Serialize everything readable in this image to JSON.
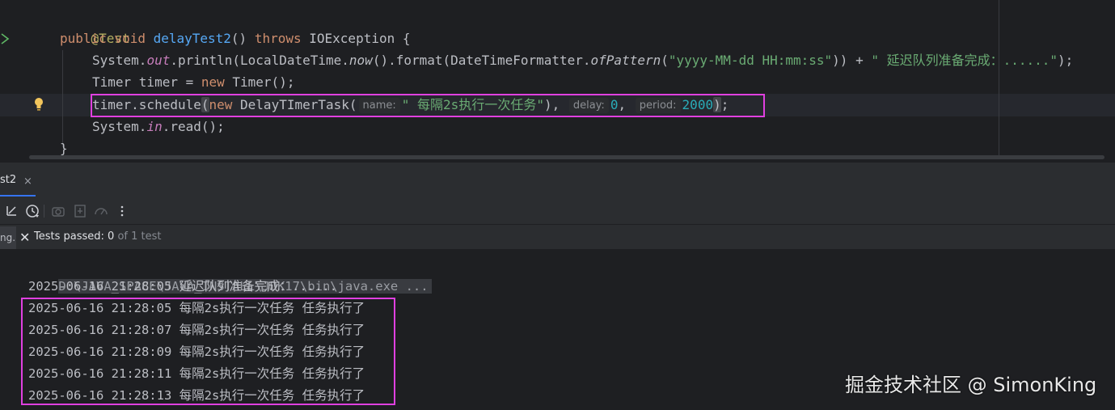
{
  "editor": {
    "lines": {
      "l1": "@Test",
      "l2_kw1": "public void ",
      "l2_fn": "delayTest2",
      "l2_rest": "() ",
      "l2_kw2": "throws ",
      "l2_exc": "IOException {",
      "l3_a": "System.",
      "l3_out": "out",
      "l3_b": ".println(LocalDateTime.",
      "l3_now": "now",
      "l3_c": "().format(DateTimeFormatter.",
      "l3_of": "ofPattern",
      "l3_d": "(",
      "l3_str1": "\"yyyy-MM-dd HH:mm:ss\"",
      "l3_e": ")) + ",
      "l3_str2": "\" 延迟队列准备完成：......\"",
      "l3_f": ");",
      "l4_a": "Timer timer = ",
      "l4_kw": "new ",
      "l4_b": "Timer();",
      "l5_a": "timer.schedule",
      "l5_paren": "(",
      "l5_kw": "new ",
      "l5_b": "DelayTImerTask(",
      "l5_hint_name": "name:",
      "l5_str": "\" 每隔2s执行一次任务\"",
      "l5_c": "),",
      "l5_hint_delay": "delay:",
      "l5_num1": "0",
      "l5_d": ",",
      "l5_hint_period": "period:",
      "l5_num2": "2000",
      "l5_paren_close": ")",
      "l5_e": ";",
      "l6_a": "System.",
      "l6_in": "in",
      "l6_b": ".read();",
      "l7": "}"
    }
  },
  "run_panel": {
    "tab_label": "st2",
    "tab_close": "×",
    "side_label": "ng.",
    "status": {
      "prefix": "Tests passed: ",
      "passed": "0",
      "suffix": " of 1 test"
    }
  },
  "console": {
    "command": "D:\\JAVA_SPACE\\JAVA_INSTALL\\JDK17\\bin\\java.exe ...",
    "lines": [
      "2025-06-16 21:28:05 延迟队列准备完成：......",
      "2025-06-16 21:28:05 每隔2s执行一次任务 任务执行了",
      "2025-06-16 21:28:07 每隔2s执行一次任务 任务执行了",
      "2025-06-16 21:28:09 每隔2s执行一次任务 任务执行了",
      "2025-06-16 21:28:11 每隔2s执行一次任务 任务执行了",
      "2025-06-16 21:28:13 每隔2s执行一次任务 任务执行了"
    ]
  },
  "watermark": "掘金技术社区 @ SimonKing",
  "colors": {
    "background": "#1e1f22",
    "keyword": "#cf8e6d",
    "function": "#56a8f5",
    "string": "#6aab73",
    "number": "#2aacb8",
    "annotation": "#b3ae60",
    "highlight_box": "#e040e0"
  },
  "icons": {
    "gutter": "run-gutter-icon",
    "bulb": "lightbulb-icon",
    "toolbar": [
      "collapse-icon",
      "history-icon",
      "camera-icon",
      "import-icon",
      "gauge-icon",
      "more-vertical-icon"
    ],
    "status": "close-icon"
  }
}
